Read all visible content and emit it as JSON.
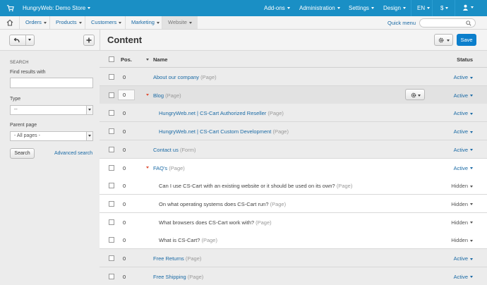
{
  "topbar": {
    "store": "HungryWeb: Demo Store",
    "menus": [
      "Add-ons",
      "Administration",
      "Settings",
      "Design",
      "EN",
      "$"
    ]
  },
  "subnav": {
    "items": [
      "Orders",
      "Products",
      "Customers",
      "Marketing",
      "Website"
    ],
    "active": "Website",
    "quick_menu": "Quick menu",
    "search_placeholder": ""
  },
  "sidebar": {
    "section": "SEARCH",
    "find_label": "Find results with",
    "find_value": "",
    "type_label": "Type",
    "type_value": "--",
    "parent_label": "Parent page",
    "parent_value": "- All pages -",
    "search_button": "Search",
    "advanced": "Advanced search"
  },
  "main": {
    "title": "Content",
    "save": "Save",
    "headers": {
      "pos": "Pos.",
      "name": "Name",
      "status": "Status"
    },
    "rows": [
      {
        "pos": "0",
        "name": "About our company",
        "kind": "(Page)",
        "status": "Active",
        "level": 0,
        "toggle": false,
        "style": "normal"
      },
      {
        "pos": "0",
        "name": "Blog",
        "kind": "(Page)",
        "status": "Active",
        "level": 0,
        "toggle": true,
        "style": "selected"
      },
      {
        "pos": "0",
        "name": "HungryWeb.net | CS-Cart Authorized Reseller",
        "kind": "(Page)",
        "status": "Active",
        "level": 1,
        "toggle": false,
        "style": "normal"
      },
      {
        "pos": "0",
        "name": "HungryWeb.net | CS-Cart Custom Development",
        "kind": "(Page)",
        "status": "Active",
        "level": 1,
        "toggle": false,
        "style": "normal"
      },
      {
        "pos": "0",
        "name": "Contact us",
        "kind": "(Form)",
        "status": "Active",
        "level": 0,
        "toggle": false,
        "style": "normal"
      },
      {
        "pos": "0",
        "name": "FAQ's",
        "kind": "(Page)",
        "status": "Active",
        "level": 0,
        "toggle": true,
        "style": "highlight"
      },
      {
        "pos": "0",
        "name": "Can I use CS-Cart with an existing website or it should be used on its own?",
        "kind": "(Page)",
        "status": "Hidden",
        "level": 1,
        "toggle": false,
        "style": "highlight"
      },
      {
        "pos": "0",
        "name": "On what operating systems does CS-Cart run?",
        "kind": "(Page)",
        "status": "Hidden",
        "level": 1,
        "toggle": false,
        "style": "highlight"
      },
      {
        "pos": "0",
        "name": "What browsers does CS-Cart work with?",
        "kind": "(Page)",
        "status": "Hidden",
        "level": 1,
        "toggle": false,
        "style": "highlight"
      },
      {
        "pos": "0",
        "name": "What is CS-Cart?",
        "kind": "(Page)",
        "status": "Hidden",
        "level": 1,
        "toggle": false,
        "style": "highlight"
      },
      {
        "pos": "0",
        "name": "Free Returns",
        "kind": "(Page)",
        "status": "Active",
        "level": 0,
        "toggle": false,
        "style": "normal"
      },
      {
        "pos": "0",
        "name": "Free Shipping",
        "kind": "(Page)",
        "status": "Active",
        "level": 0,
        "toggle": false,
        "style": "normal"
      }
    ]
  },
  "colors": {
    "topbar": "#1a8fc5",
    "link": "#1a6aa5",
    "save": "#0c7fcc",
    "toggle": "#e0533a"
  }
}
